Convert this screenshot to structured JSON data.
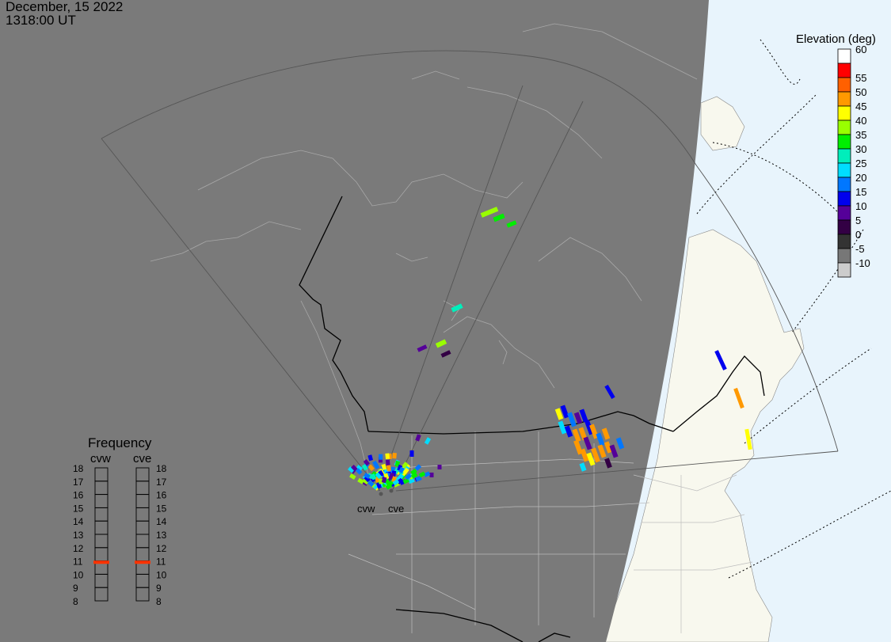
{
  "header": {
    "date": "December, 15 2022",
    "time": "1318:00 UT"
  },
  "elevation_legend": {
    "title": "Elevation (deg)",
    "entries": [
      {
        "label": "60",
        "color": "#ffffff"
      },
      {
        "label": "",
        "color": "#ff0000"
      },
      {
        "label": "55",
        "color": "#ff6000"
      },
      {
        "label": "50",
        "color": "#ff9900"
      },
      {
        "label": "45",
        "color": "#ffff00"
      },
      {
        "label": "40",
        "color": "#99ff00"
      },
      {
        "label": "35",
        "color": "#00ee00"
      },
      {
        "label": "30",
        "color": "#00eebb"
      },
      {
        "label": "25",
        "color": "#00ddff"
      },
      {
        "label": "20",
        "color": "#0077ff"
      },
      {
        "label": "15",
        "color": "#0000ee"
      },
      {
        "label": "10",
        "color": "#550099"
      },
      {
        "label": "5",
        "color": "#330044"
      },
      {
        "label": "0",
        "color": "#333333"
      },
      {
        "label": "-5",
        "color": "#777777"
      },
      {
        "label": "-10",
        "color": "#cccccc"
      }
    ]
  },
  "frequency_panel": {
    "title": "Frequency",
    "columns": [
      {
        "name": "cvw",
        "current": 10.9
      },
      {
        "name": "cve",
        "current": 10.9
      }
    ],
    "levels": [
      "18",
      "17",
      "16",
      "15",
      "14",
      "13",
      "12",
      "11",
      "10",
      "9",
      "8"
    ],
    "marker_color": "#ff3300"
  },
  "radars": [
    {
      "name": "cvw"
    },
    {
      "name": "cve"
    }
  ],
  "colors": {
    "night": "#7a7a7a",
    "land": "#f8f8ee",
    "ocean": "#e8f4fc"
  }
}
